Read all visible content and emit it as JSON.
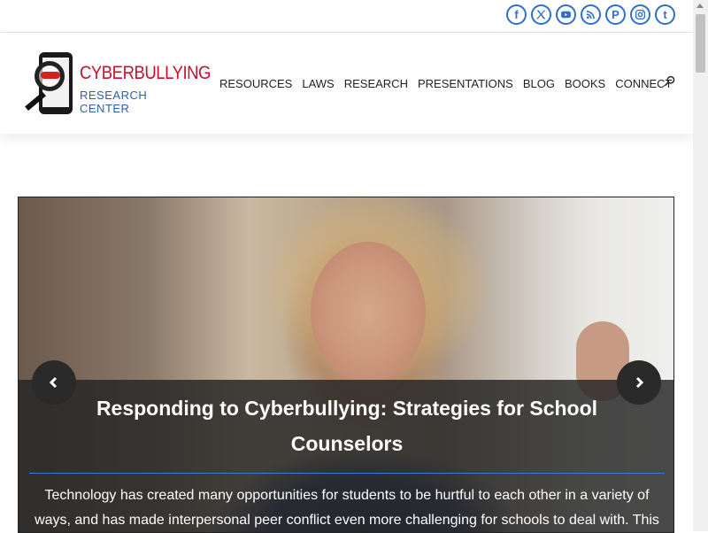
{
  "social": [
    {
      "name": "facebook-icon",
      "glyph": "f"
    },
    {
      "name": "x-icon",
      "glyph": "𝕏"
    },
    {
      "name": "youtube-icon",
      "glyph": "▶"
    },
    {
      "name": "rss-icon",
      "glyph": "rss"
    },
    {
      "name": "pinterest-icon",
      "glyph": "P"
    },
    {
      "name": "instagram-icon",
      "glyph": "◎"
    },
    {
      "name": "tumblr-icon",
      "glyph": "t"
    }
  ],
  "logo": {
    "title": "CYBERBULLYING",
    "subtitle": "RESEARCH CENTER"
  },
  "nav": [
    "RESOURCES",
    "LAWS",
    "RESEARCH",
    "PRESENTATIONS",
    "BLOG",
    "BOOKS",
    "CONNECT"
  ],
  "slide": {
    "title": "Responding to Cyberbullying: Strategies for School Counselors",
    "text": "Technology has created many opportunities for students to be hurtful to each other in a variety of ways, and has made interpersonal peer conflict even more challenging for schools to deal with. This"
  },
  "colors": {
    "brand_red": "#c8102e",
    "brand_blue": "#2d5fa8",
    "social_blue": "#2f6fc9",
    "accent_line": "#3a7bd5"
  }
}
